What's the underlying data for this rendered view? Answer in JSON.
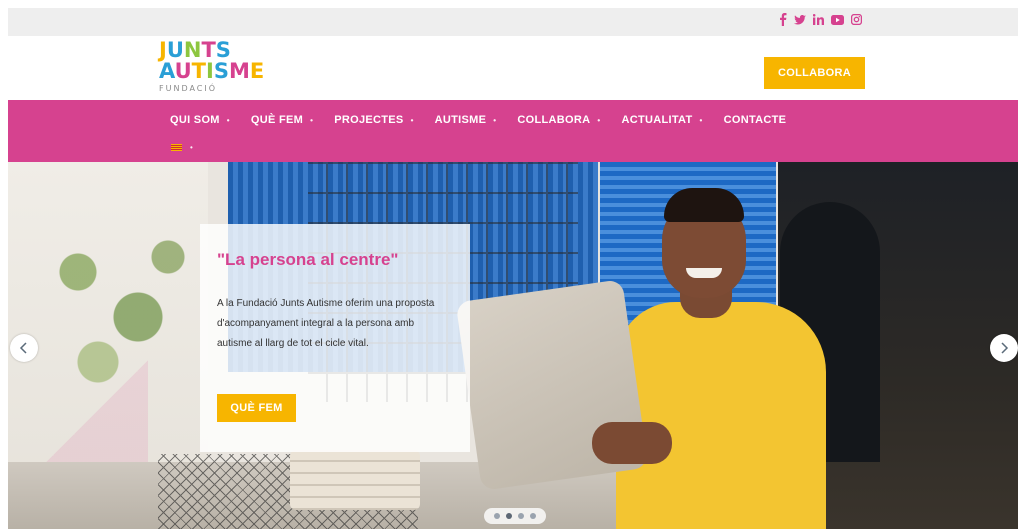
{
  "social": [
    {
      "name": "facebook-icon",
      "glyph": "f"
    },
    {
      "name": "twitter-icon",
      "glyph": "t"
    },
    {
      "name": "linkedin-icon",
      "glyph": "in"
    },
    {
      "name": "youtube-icon",
      "glyph": "yt"
    },
    {
      "name": "instagram-icon",
      "glyph": "ig"
    }
  ],
  "logo": {
    "line1": "JUNTS",
    "line2": "AUTISME",
    "sub": "FUNDACIÓ"
  },
  "header": {
    "cta_label": "COLLABORA"
  },
  "nav": {
    "items": [
      {
        "label": "QUI SOM",
        "caret": "•"
      },
      {
        "label": "QUÈ FEM",
        "caret": "•"
      },
      {
        "label": "PROJECTES",
        "caret": "•"
      },
      {
        "label": "AUTISME",
        "caret": "•"
      },
      {
        "label": "COLLABORA",
        "caret": "•"
      },
      {
        "label": "ACTUALITAT",
        "caret": "•"
      },
      {
        "label": "CONTACTE",
        "caret": ""
      }
    ],
    "lang_caret": "•"
  },
  "hero": {
    "title": "\"La persona al centre\"",
    "text": "A la Fundació Junts Autisme oferim una proposta d'acompanyament integral a la persona amb autisme al llarg de tot el cicle vital.",
    "button_label": "QUÈ FEM",
    "active_slide": 2,
    "slide_count": 4
  },
  "colors": {
    "brand_pink": "#d6428f",
    "brand_yellow": "#f7b500",
    "topbar_gray": "#eeeeee"
  }
}
